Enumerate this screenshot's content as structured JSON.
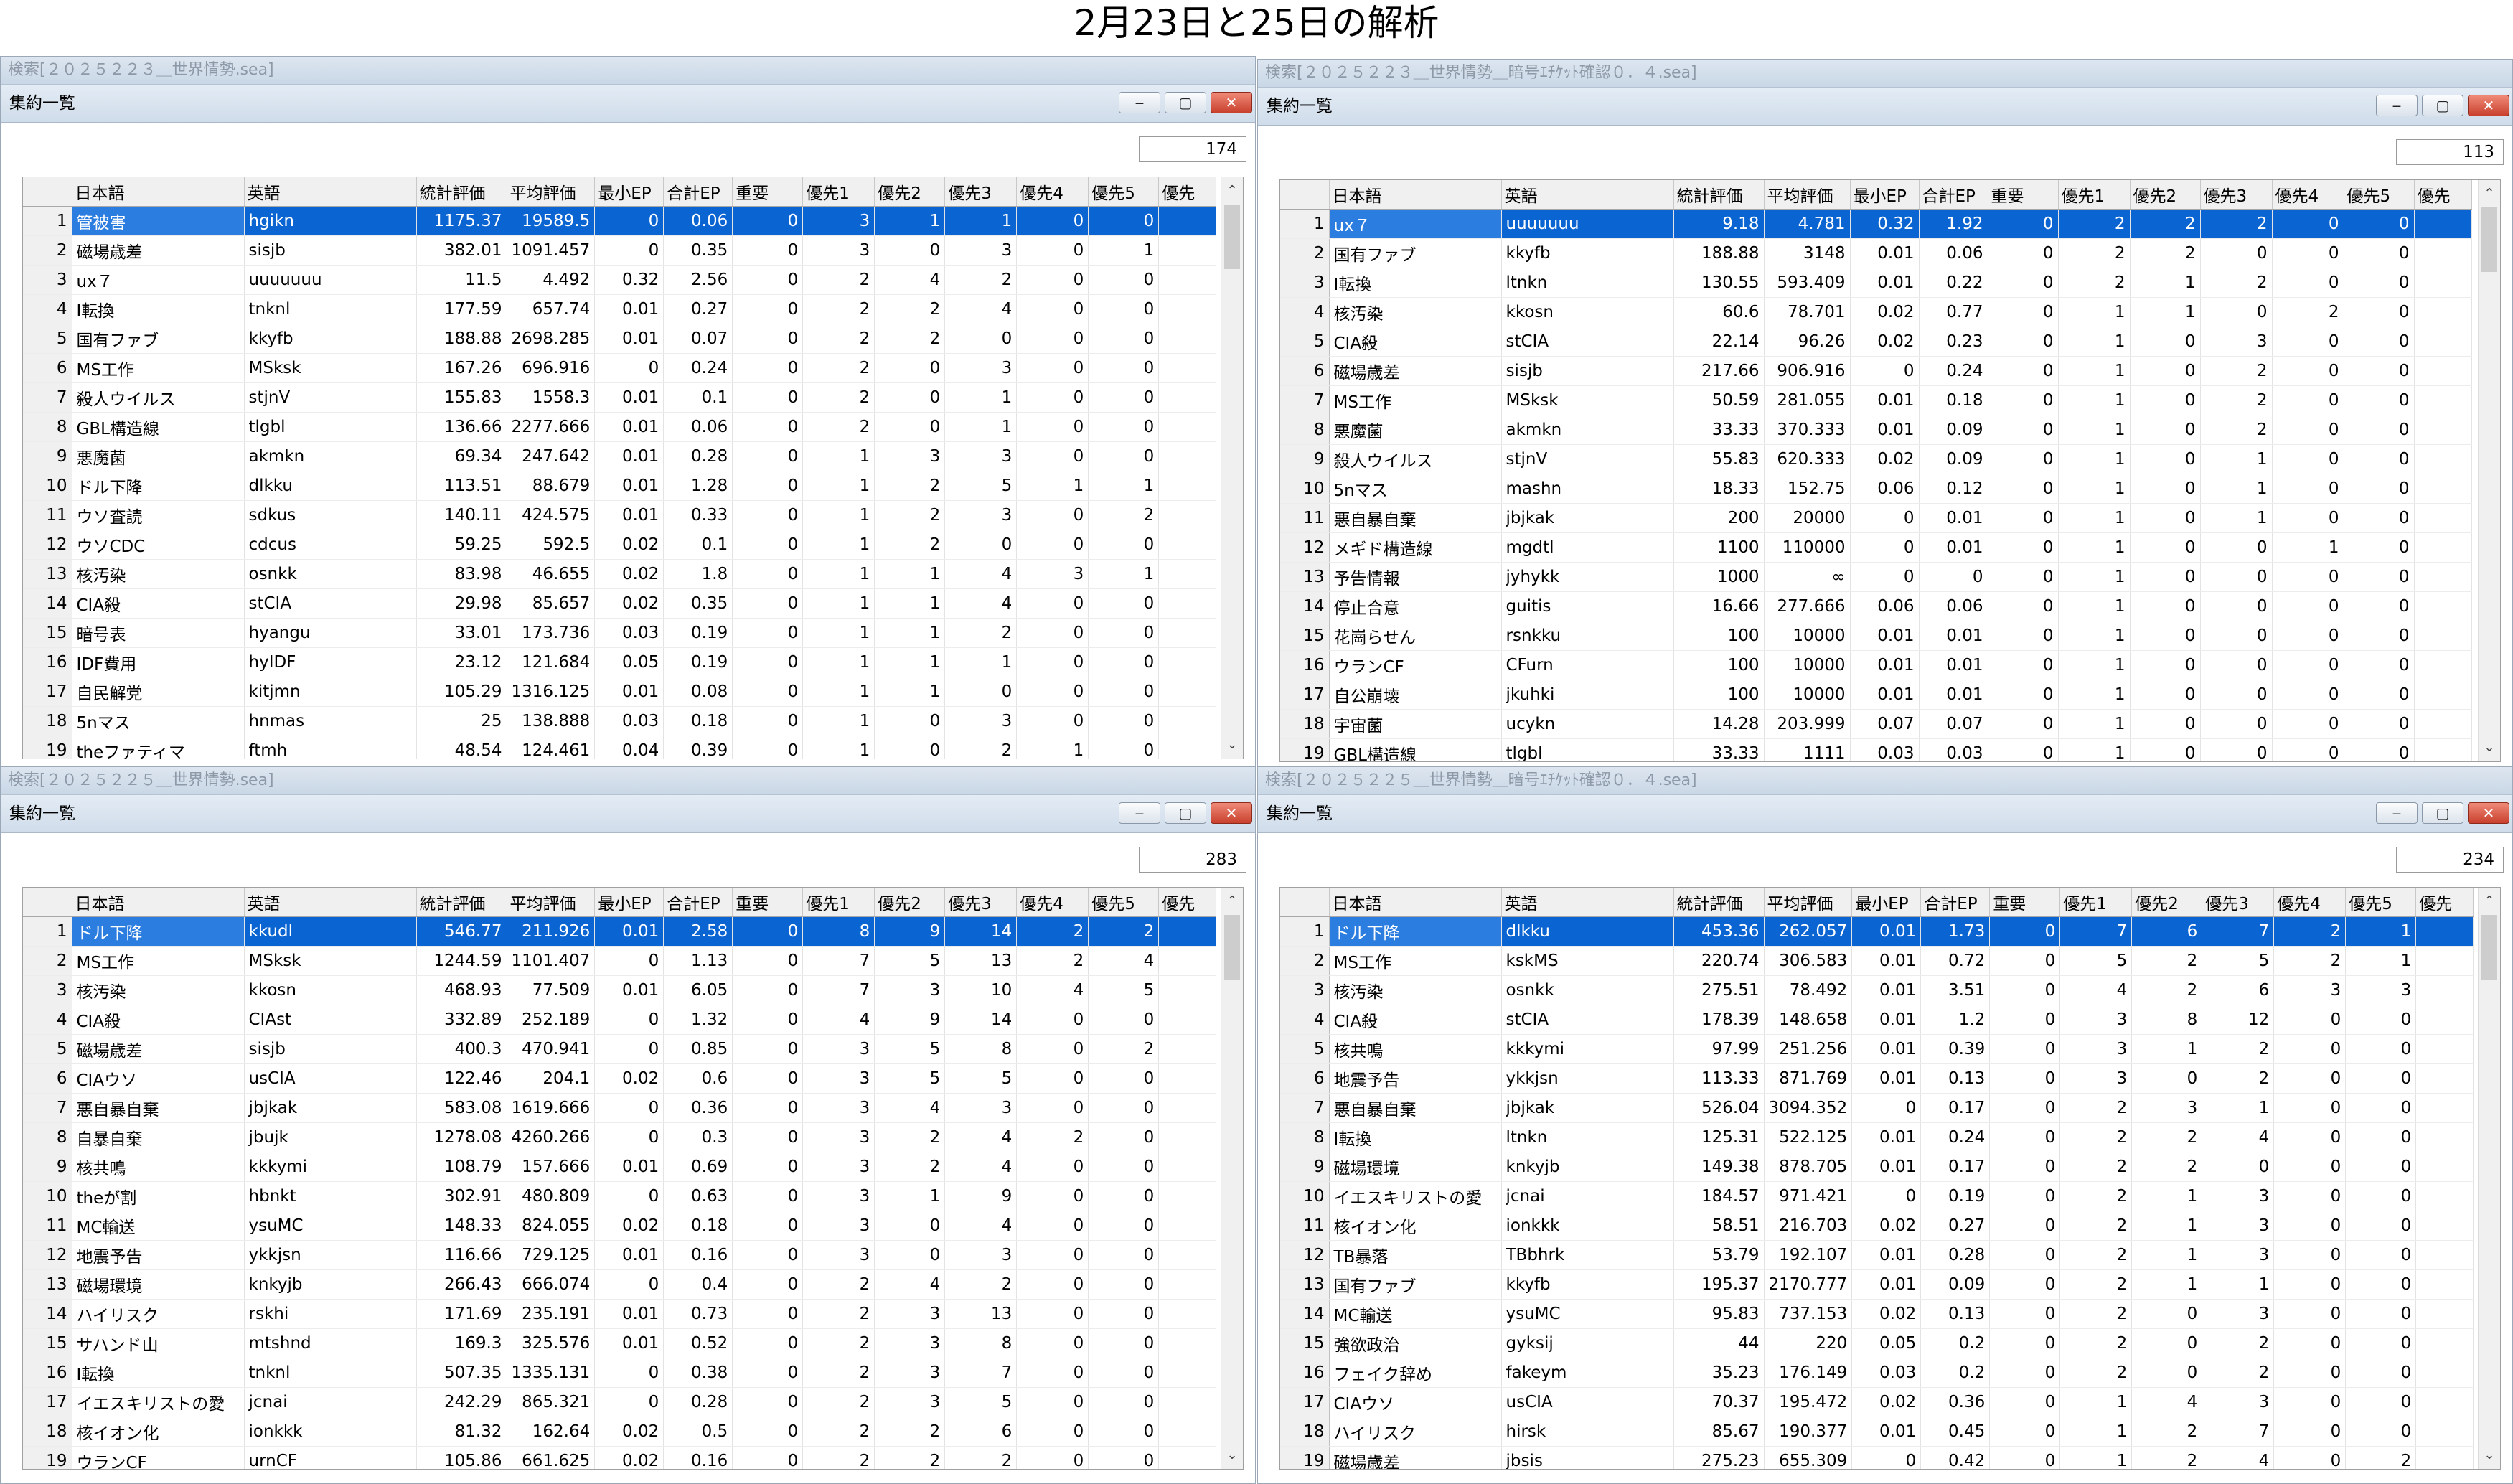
{
  "page_title": "2月23日と25日の解析",
  "window_buttons": {
    "minimize": "‒",
    "maximize": "▢",
    "close": "✕"
  },
  "panes": [
    {
      "window_title": "検索[２０２５２２３＿世界情勢.sea]",
      "panel_title": "集約一覧",
      "count": "174",
      "columns": [
        "",
        "日本語",
        "英語",
        "統計評価",
        "平均評価",
        "最小EP",
        "合計EP",
        "重要",
        "優先1",
        "優先2",
        "優先3",
        "優先4",
        "優先5",
        "優先"
      ],
      "rows": [
        [
          "1",
          "管被害",
          "hgikn",
          "1175.37",
          "19589.5",
          "0",
          "0.06",
          "0",
          "3",
          "1",
          "1",
          "0",
          "0"
        ],
        [
          "2",
          "磁場歳差",
          "sisjb",
          "382.01",
          "1091.457",
          "0",
          "0.35",
          "0",
          "3",
          "0",
          "3",
          "0",
          "1"
        ],
        [
          "3",
          "ux７",
          "uuuuuuu",
          "11.5",
          "4.492",
          "0.32",
          "2.56",
          "0",
          "2",
          "4",
          "2",
          "0",
          "0"
        ],
        [
          "4",
          "I転換",
          "tnknl",
          "177.59",
          "657.74",
          "0.01",
          "0.27",
          "0",
          "2",
          "2",
          "4",
          "0",
          "0"
        ],
        [
          "5",
          "国有ファブ",
          "kkyfb",
          "188.88",
          "2698.285",
          "0.01",
          "0.07",
          "0",
          "2",
          "2",
          "0",
          "0",
          "0"
        ],
        [
          "6",
          "MS工作",
          "MSksk",
          "167.26",
          "696.916",
          "0",
          "0.24",
          "0",
          "2",
          "0",
          "3",
          "0",
          "0"
        ],
        [
          "7",
          "殺人ウイルス",
          "stjnV",
          "155.83",
          "1558.3",
          "0.01",
          "0.1",
          "0",
          "2",
          "0",
          "1",
          "0",
          "0"
        ],
        [
          "8",
          "GBL構造線",
          "tlgbl",
          "136.66",
          "2277.666",
          "0.01",
          "0.06",
          "0",
          "2",
          "0",
          "1",
          "0",
          "0"
        ],
        [
          "9",
          "悪魔菌",
          "akmkn",
          "69.34",
          "247.642",
          "0.01",
          "0.28",
          "0",
          "1",
          "3",
          "3",
          "0",
          "0"
        ],
        [
          "10",
          "ドル下降",
          "dlkku",
          "113.51",
          "88.679",
          "0.01",
          "1.28",
          "0",
          "1",
          "2",
          "5",
          "1",
          "1"
        ],
        [
          "11",
          "ウソ査読",
          "sdkus",
          "140.11",
          "424.575",
          "0.01",
          "0.33",
          "0",
          "1",
          "2",
          "3",
          "0",
          "2"
        ],
        [
          "12",
          "ウソCDC",
          "cdcus",
          "59.25",
          "592.5",
          "0.02",
          "0.1",
          "0",
          "1",
          "2",
          "0",
          "0",
          "0"
        ],
        [
          "13",
          "核汚染",
          "osnkk",
          "83.98",
          "46.655",
          "0.02",
          "1.8",
          "0",
          "1",
          "1",
          "4",
          "3",
          "1"
        ],
        [
          "14",
          "CIA殺",
          "stCIA",
          "29.98",
          "85.657",
          "0.02",
          "0.35",
          "0",
          "1",
          "1",
          "4",
          "0",
          "0"
        ],
        [
          "15",
          "暗号表",
          "hyangu",
          "33.01",
          "173.736",
          "0.03",
          "0.19",
          "0",
          "1",
          "1",
          "2",
          "0",
          "0"
        ],
        [
          "16",
          "IDF費用",
          "hyIDF",
          "23.12",
          "121.684",
          "0.05",
          "0.19",
          "0",
          "1",
          "1",
          "1",
          "0",
          "0"
        ],
        [
          "17",
          "自民解党",
          "kitjmn",
          "105.29",
          "1316.125",
          "0.01",
          "0.08",
          "0",
          "1",
          "1",
          "0",
          "0",
          "0"
        ],
        [
          "18",
          "5nマス",
          "hnmas",
          "25",
          "138.888",
          "0.03",
          "0.18",
          "0",
          "1",
          "0",
          "3",
          "0",
          "0"
        ],
        [
          "19",
          "theファティマ",
          "ftmh",
          "48.54",
          "124.461",
          "0.04",
          "0.39",
          "0",
          "1",
          "0",
          "2",
          "1",
          "0"
        ]
      ]
    },
    {
      "window_title": "検索[２０２５２２３＿世界情勢＿暗号ｴﾁｹｯﾄ確認０．４.sea]",
      "panel_title": "集約一覧",
      "count": "113",
      "columns": [
        "",
        "日本語",
        "英語",
        "統計評価",
        "平均評価",
        "最小EP",
        "合計EP",
        "重要",
        "優先1",
        "優先2",
        "優先3",
        "優先4",
        "優先5",
        "優先"
      ],
      "rows": [
        [
          "1",
          "ux７",
          "uuuuuuu",
          "9.18",
          "4.781",
          "0.32",
          "1.92",
          "0",
          "2",
          "2",
          "2",
          "0",
          "0"
        ],
        [
          "2",
          "国有ファブ",
          "kkyfb",
          "188.88",
          "3148",
          "0.01",
          "0.06",
          "0",
          "2",
          "2",
          "0",
          "0",
          "0"
        ],
        [
          "3",
          "I転換",
          "ltnkn",
          "130.55",
          "593.409",
          "0.01",
          "0.22",
          "0",
          "2",
          "1",
          "2",
          "0",
          "0"
        ],
        [
          "4",
          "核汚染",
          "kkosn",
          "60.6",
          "78.701",
          "0.02",
          "0.77",
          "0",
          "1",
          "1",
          "0",
          "2",
          "0"
        ],
        [
          "5",
          "CIA殺",
          "stCIA",
          "22.14",
          "96.26",
          "0.02",
          "0.23",
          "0",
          "1",
          "0",
          "3",
          "0",
          "0"
        ],
        [
          "6",
          "磁場歳差",
          "sisjb",
          "217.66",
          "906.916",
          "0",
          "0.24",
          "0",
          "1",
          "0",
          "2",
          "0",
          "0"
        ],
        [
          "7",
          "MS工作",
          "MSksk",
          "50.59",
          "281.055",
          "0.01",
          "0.18",
          "0",
          "1",
          "0",
          "2",
          "0",
          "0"
        ],
        [
          "8",
          "悪魔菌",
          "akmkn",
          "33.33",
          "370.333",
          "0.01",
          "0.09",
          "0",
          "1",
          "0",
          "2",
          "0",
          "0"
        ],
        [
          "9",
          "殺人ウイルス",
          "stjnV",
          "55.83",
          "620.333",
          "0.02",
          "0.09",
          "0",
          "1",
          "0",
          "1",
          "0",
          "0"
        ],
        [
          "10",
          "5nマス",
          "mashn",
          "18.33",
          "152.75",
          "0.06",
          "0.12",
          "0",
          "1",
          "0",
          "1",
          "0",
          "0"
        ],
        [
          "11",
          "悪自暴自棄",
          "jbjkak",
          "200",
          "20000",
          "0",
          "0.01",
          "0",
          "1",
          "0",
          "1",
          "0",
          "0"
        ],
        [
          "12",
          "メギド構造線",
          "mgdtl",
          "1100",
          "110000",
          "0",
          "0.01",
          "0",
          "1",
          "0",
          "0",
          "1",
          "0"
        ],
        [
          "13",
          "予告情報",
          "jyhykk",
          "1000",
          "∞",
          "0",
          "0",
          "0",
          "1",
          "0",
          "0",
          "0",
          "0"
        ],
        [
          "14",
          "停止合意",
          "guitis",
          "16.66",
          "277.666",
          "0.06",
          "0.06",
          "0",
          "1",
          "0",
          "0",
          "0",
          "0"
        ],
        [
          "15",
          "花崗らせん",
          "rsnkku",
          "100",
          "10000",
          "0.01",
          "0.01",
          "0",
          "1",
          "0",
          "0",
          "0",
          "0"
        ],
        [
          "16",
          "ウランCF",
          "CFurn",
          "100",
          "10000",
          "0.01",
          "0.01",
          "0",
          "1",
          "0",
          "0",
          "0",
          "0"
        ],
        [
          "17",
          "自公崩壊",
          "jkuhki",
          "100",
          "10000",
          "0.01",
          "0.01",
          "0",
          "1",
          "0",
          "0",
          "0",
          "0"
        ],
        [
          "18",
          "宇宙菌",
          "ucykn",
          "14.28",
          "203.999",
          "0.07",
          "0.07",
          "0",
          "1",
          "0",
          "0",
          "0",
          "0"
        ],
        [
          "19",
          "GBL構造線",
          "tlgbl",
          "33.33",
          "1111",
          "0.03",
          "0.03",
          "0",
          "1",
          "0",
          "0",
          "0",
          "0"
        ]
      ]
    },
    {
      "window_title": "検索[２０２５２２５＿世界情勢.sea]",
      "panel_title": "集約一覧",
      "count": "283",
      "columns": [
        "",
        "日本語",
        "英語",
        "統計評価",
        "平均評価",
        "最小EP",
        "合計EP",
        "重要",
        "優先1",
        "優先2",
        "優先3",
        "優先4",
        "優先5",
        "優先"
      ],
      "rows": [
        [
          "1",
          "ドル下降",
          "kkudl",
          "546.77",
          "211.926",
          "0.01",
          "2.58",
          "0",
          "8",
          "9",
          "14",
          "2",
          "2"
        ],
        [
          "2",
          "MS工作",
          "MSksk",
          "1244.59",
          "1101.407",
          "0",
          "1.13",
          "0",
          "7",
          "5",
          "13",
          "2",
          "4"
        ],
        [
          "3",
          "核汚染",
          "kkosn",
          "468.93",
          "77.509",
          "0.01",
          "6.05",
          "0",
          "7",
          "3",
          "10",
          "4",
          "5"
        ],
        [
          "4",
          "CIA殺",
          "CIAst",
          "332.89",
          "252.189",
          "0",
          "1.32",
          "0",
          "4",
          "9",
          "14",
          "0",
          "0"
        ],
        [
          "5",
          "磁場歳差",
          "sisjb",
          "400.3",
          "470.941",
          "0",
          "0.85",
          "0",
          "3",
          "5",
          "8",
          "0",
          "2"
        ],
        [
          "6",
          "CIAウソ",
          "usCIA",
          "122.46",
          "204.1",
          "0.02",
          "0.6",
          "0",
          "3",
          "5",
          "5",
          "0",
          "0"
        ],
        [
          "7",
          "悪自暴自棄",
          "jbjkak",
          "583.08",
          "1619.666",
          "0",
          "0.36",
          "0",
          "3",
          "4",
          "3",
          "0",
          "0"
        ],
        [
          "8",
          "自暴自棄",
          "jbujk",
          "1278.08",
          "4260.266",
          "0",
          "0.3",
          "0",
          "3",
          "2",
          "4",
          "2",
          "0"
        ],
        [
          "9",
          "核共鳴",
          "kkkymi",
          "108.79",
          "157.666",
          "0.01",
          "0.69",
          "0",
          "3",
          "2",
          "4",
          "0",
          "0"
        ],
        [
          "10",
          "theが割",
          "hbnkt",
          "302.91",
          "480.809",
          "0",
          "0.63",
          "0",
          "3",
          "1",
          "9",
          "0",
          "0"
        ],
        [
          "11",
          "MC輸送",
          "ysuMC",
          "148.33",
          "824.055",
          "0.02",
          "0.18",
          "0",
          "3",
          "0",
          "4",
          "0",
          "0"
        ],
        [
          "12",
          "地震予告",
          "ykkjsn",
          "116.66",
          "729.125",
          "0.01",
          "0.16",
          "0",
          "3",
          "0",
          "3",
          "0",
          "0"
        ],
        [
          "13",
          "磁場環境",
          "knkyjb",
          "266.43",
          "666.074",
          "0",
          "0.4",
          "0",
          "2",
          "4",
          "2",
          "0",
          "0"
        ],
        [
          "14",
          "ハイリスク",
          "rskhi",
          "171.69",
          "235.191",
          "0.01",
          "0.73",
          "0",
          "2",
          "3",
          "13",
          "0",
          "0"
        ],
        [
          "15",
          "サハンド山",
          "mtshnd",
          "169.3",
          "325.576",
          "0.01",
          "0.52",
          "0",
          "2",
          "3",
          "8",
          "0",
          "0"
        ],
        [
          "16",
          "I転換",
          "tnknl",
          "507.35",
          "1335.131",
          "0",
          "0.38",
          "0",
          "2",
          "3",
          "7",
          "0",
          "0"
        ],
        [
          "17",
          "イエスキリストの愛",
          "jcnai",
          "242.29",
          "865.321",
          "0",
          "0.28",
          "0",
          "2",
          "3",
          "5",
          "0",
          "0"
        ],
        [
          "18",
          "核イオン化",
          "ionkkk",
          "81.32",
          "162.64",
          "0.02",
          "0.5",
          "0",
          "2",
          "2",
          "6",
          "0",
          "0"
        ],
        [
          "19",
          "ウランCF",
          "urnCF",
          "105.86",
          "661.625",
          "0.02",
          "0.16",
          "0",
          "2",
          "2",
          "2",
          "0",
          "0"
        ]
      ]
    },
    {
      "window_title": "検索[２０２５２２５＿世界情勢＿暗号ｴﾁｹｯﾄ確認０．４.sea]",
      "panel_title": "集約一覧",
      "count": "234",
      "columns": [
        "",
        "日本語",
        "英語",
        "統計評価",
        "平均評価",
        "最小EP",
        "合計EP",
        "重要",
        "優先1",
        "優先2",
        "優先3",
        "優先4",
        "優先5",
        "優先"
      ],
      "rows": [
        [
          "1",
          "ドル下降",
          "dlkku",
          "453.36",
          "262.057",
          "0.01",
          "1.73",
          "0",
          "7",
          "6",
          "7",
          "2",
          "1"
        ],
        [
          "2",
          "MS工作",
          "kskMS",
          "220.74",
          "306.583",
          "0.01",
          "0.72",
          "0",
          "5",
          "2",
          "5",
          "2",
          "1"
        ],
        [
          "3",
          "核汚染",
          "osnkk",
          "275.51",
          "78.492",
          "0.01",
          "3.51",
          "0",
          "4",
          "2",
          "6",
          "3",
          "3"
        ],
        [
          "4",
          "CIA殺",
          "stCIA",
          "178.39",
          "148.658",
          "0.01",
          "1.2",
          "0",
          "3",
          "8",
          "12",
          "0",
          "0"
        ],
        [
          "5",
          "核共鳴",
          "kkkymi",
          "97.99",
          "251.256",
          "0.01",
          "0.39",
          "0",
          "3",
          "1",
          "2",
          "0",
          "0"
        ],
        [
          "6",
          "地震予告",
          "ykkjsn",
          "113.33",
          "871.769",
          "0.01",
          "0.13",
          "0",
          "3",
          "0",
          "2",
          "0",
          "0"
        ],
        [
          "7",
          "悪自暴自棄",
          "jbjkak",
          "526.04",
          "3094.352",
          "0",
          "0.17",
          "0",
          "2",
          "3",
          "1",
          "0",
          "0"
        ],
        [
          "8",
          "I転換",
          "ltnkn",
          "125.31",
          "522.125",
          "0.01",
          "0.24",
          "0",
          "2",
          "2",
          "4",
          "0",
          "0"
        ],
        [
          "9",
          "磁場環境",
          "knkyjb",
          "149.38",
          "878.705",
          "0.01",
          "0.17",
          "0",
          "2",
          "2",
          "0",
          "0",
          "0"
        ],
        [
          "10",
          "イエスキリストの愛",
          "jcnai",
          "184.57",
          "971.421",
          "0",
          "0.19",
          "0",
          "2",
          "1",
          "3",
          "0",
          "0"
        ],
        [
          "11",
          "核イオン化",
          "ionkkk",
          "58.51",
          "216.703",
          "0.02",
          "0.27",
          "0",
          "2",
          "1",
          "3",
          "0",
          "0"
        ],
        [
          "12",
          "TB暴落",
          "TBbhrk",
          "53.79",
          "192.107",
          "0.01",
          "0.28",
          "0",
          "2",
          "1",
          "3",
          "0",
          "0"
        ],
        [
          "13",
          "国有ファブ",
          "kkyfb",
          "195.37",
          "2170.777",
          "0.01",
          "0.09",
          "0",
          "2",
          "1",
          "1",
          "0",
          "0"
        ],
        [
          "14",
          "MC輸送",
          "ysuMC",
          "95.83",
          "737.153",
          "0.02",
          "0.13",
          "0",
          "2",
          "0",
          "3",
          "0",
          "0"
        ],
        [
          "15",
          "強欲政治",
          "gyksij",
          "44",
          "220",
          "0.05",
          "0.2",
          "0",
          "2",
          "0",
          "2",
          "0",
          "0"
        ],
        [
          "16",
          "フェイク辞め",
          "fakeym",
          "35.23",
          "176.149",
          "0.03",
          "0.2",
          "0",
          "2",
          "0",
          "2",
          "0",
          "0"
        ],
        [
          "17",
          "CIAウソ",
          "usCIA",
          "70.37",
          "195.472",
          "0.02",
          "0.36",
          "0",
          "1",
          "4",
          "3",
          "0",
          "0"
        ],
        [
          "18",
          "ハイリスク",
          "hirsk",
          "85.67",
          "190.377",
          "0.01",
          "0.45",
          "0",
          "1",
          "2",
          "7",
          "0",
          "0"
        ],
        [
          "19",
          "磁場歳差",
          "jbsis",
          "275.23",
          "655.309",
          "0",
          "0.42",
          "0",
          "1",
          "2",
          "4",
          "0",
          "2"
        ]
      ]
    }
  ]
}
